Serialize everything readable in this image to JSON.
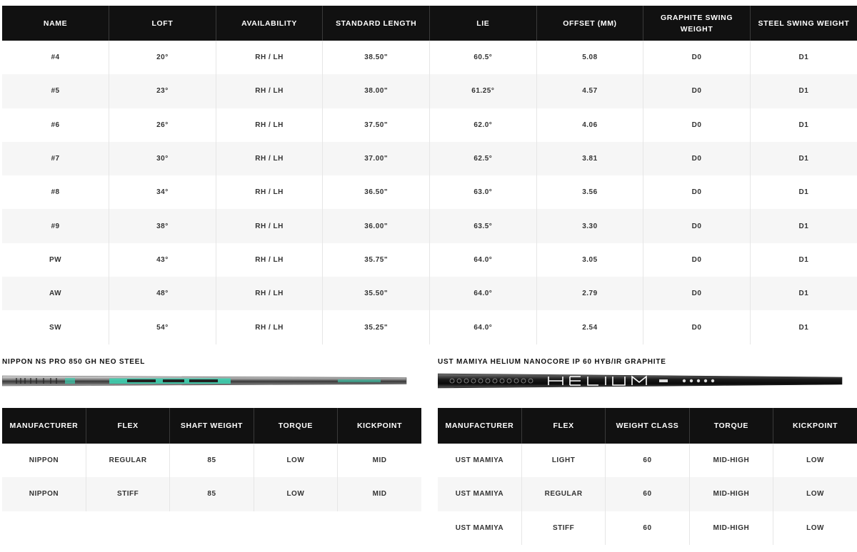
{
  "club_specs": {
    "headers": [
      "NAME",
      "LOFT",
      "AVAILABILITY",
      "STANDARD LENGTH",
      "LIE",
      "OFFSET (MM)",
      "GRAPHITE SWING WEIGHT",
      "STEEL SWING WEIGHT"
    ],
    "rows": [
      [
        "#4",
        "20°",
        "RH / LH",
        "38.50\"",
        "60.5°",
        "5.08",
        "D0",
        "D1"
      ],
      [
        "#5",
        "23°",
        "RH / LH",
        "38.00\"",
        "61.25°",
        "4.57",
        "D0",
        "D1"
      ],
      [
        "#6",
        "26°",
        "RH / LH",
        "37.50\"",
        "62.0°",
        "4.06",
        "D0",
        "D1"
      ],
      [
        "#7",
        "30°",
        "RH / LH",
        "37.00\"",
        "62.5°",
        "3.81",
        "D0",
        "D1"
      ],
      [
        "#8",
        "34°",
        "RH / LH",
        "36.50\"",
        "63.0°",
        "3.56",
        "D0",
        "D1"
      ],
      [
        "#9",
        "38°",
        "RH / LH",
        "36.00\"",
        "63.5°",
        "3.30",
        "D0",
        "D1"
      ],
      [
        "PW",
        "43°",
        "RH / LH",
        "35.75\"",
        "64.0°",
        "3.05",
        "D0",
        "D1"
      ],
      [
        "AW",
        "48°",
        "RH / LH",
        "35.50\"",
        "64.0°",
        "2.79",
        "D0",
        "D1"
      ],
      [
        "SW",
        "54°",
        "RH / LH",
        "35.25\"",
        "64.0°",
        "2.54",
        "D0",
        "D1"
      ]
    ]
  },
  "steel_shaft": {
    "title": "NIPPON NS PRO 850 GH NEO STEEL",
    "image_accent": "#3fd0b0",
    "headers": [
      "MANUFACTURER",
      "FLEX",
      "SHAFT WEIGHT",
      "TORQUE",
      "KICKPOINT"
    ],
    "rows": [
      [
        "NIPPON",
        "REGULAR",
        "85",
        "LOW",
        "MID"
      ],
      [
        "NIPPON",
        "STIFF",
        "85",
        "LOW",
        "MID"
      ]
    ]
  },
  "graphite_shaft": {
    "title": "UST MAMIYA HELIUM NANOCORE IP 60 HYB/IR GRAPHITE",
    "image_accent": "#ffffff",
    "headers": [
      "MANUFACTURER",
      "FLEX",
      "WEIGHT CLASS",
      "TORQUE",
      "KICKPOINT"
    ],
    "rows": [
      [
        "UST MAMIYA",
        "LIGHT",
        "60",
        "MID-HIGH",
        "LOW"
      ],
      [
        "UST MAMIYA",
        "REGULAR",
        "60",
        "MID-HIGH",
        "LOW"
      ],
      [
        "UST MAMIYA",
        "STIFF",
        "60",
        "MID-HIGH",
        "LOW"
      ]
    ]
  }
}
